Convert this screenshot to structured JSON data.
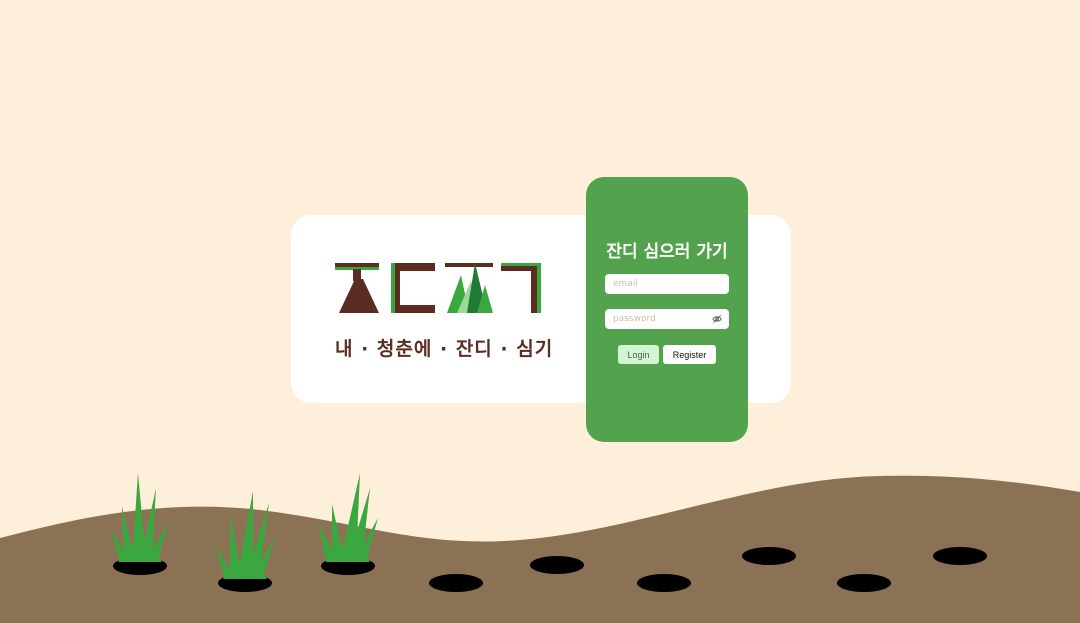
{
  "app": {
    "tagline": "내 · 청춘에 · 잔디 · 심기",
    "logo_text": "잔디심기"
  },
  "login": {
    "title": "잔디 심으러 가기",
    "email_placeholder": "email",
    "password_placeholder": "password",
    "login_label": "Login",
    "register_label": "Register",
    "eye_icon": "eye-off-icon"
  },
  "colors": {
    "background": "#fdefda",
    "soil": "#8c7254",
    "panel": "#53a24e",
    "brand_brown": "#5b2d22",
    "grass": "#3aa83f",
    "hole": "#000000",
    "login_button": "#d3f5cf"
  }
}
